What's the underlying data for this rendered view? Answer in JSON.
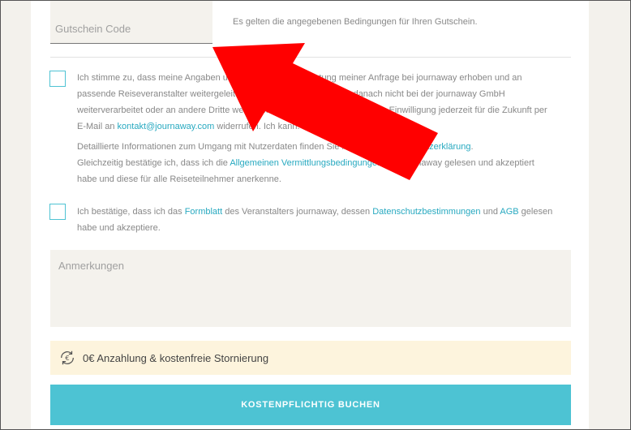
{
  "voucher": {
    "placeholder": "Gutschein Code",
    "note": "Es gelten die angegebenen Bedingungen für Ihren Gutschein."
  },
  "consent1": {
    "line1": "Ich stimme zu, dass meine Angaben und Daten zur Beantwortung meiner Anfrage bei journaway erhoben und an",
    "line2": "passende Reiseveranstalter weitergeleitet werden. Die Daten werden danach nicht bei der journaway GmbH",
    "line3": "weiterverarbeitet oder an andere Dritte weitergeleitet. Hinweis: Ich kann meine Einwilligung jederzeit für die Zukunft per",
    "line4_pre": "E-Mail an ",
    "email_link": "kontakt@journaway.com",
    "line4_post": " widerrufen. Ich kann.",
    "info_line1_pre": "Detaillierte Informationen zum Umgang mit Nutzerdaten finden Sie in unserer ",
    "privacy_link": "Datenschutzerklärung",
    "info_line1_post": ".",
    "info_line2_pre": "Gleichzeitig bestätige ich, dass ich die ",
    "terms_link": "Allgemeinen Vermittlungsbedingungen",
    "info_line2_post": " von journaway gelesen und akzeptiert",
    "info_line3": "habe und diese für alle Reiseteilnehmer anerkenne."
  },
  "consent2": {
    "pre": "Ich bestätige, dass ich das ",
    "form_link": "Formblatt",
    "mid1": " des Veranstalters journaway, dessen ",
    "privacy_link": "Datenschutzbestimmungen",
    "mid2": " und ",
    "agb_link": "AGB",
    "post": " gelesen",
    "line2": "habe und akzeptiere."
  },
  "remarks": {
    "placeholder": "Anmerkungen"
  },
  "promo": {
    "text": "0€ Anzahlung & kostenfreie Stornierung"
  },
  "book_button": {
    "label": "KOSTENPFLICHTIG BUCHEN"
  },
  "colors": {
    "accent": "#4dc3d3",
    "link": "#27a9c0",
    "arrow": "#ff0000",
    "promo_bg": "#fdf4dd"
  }
}
